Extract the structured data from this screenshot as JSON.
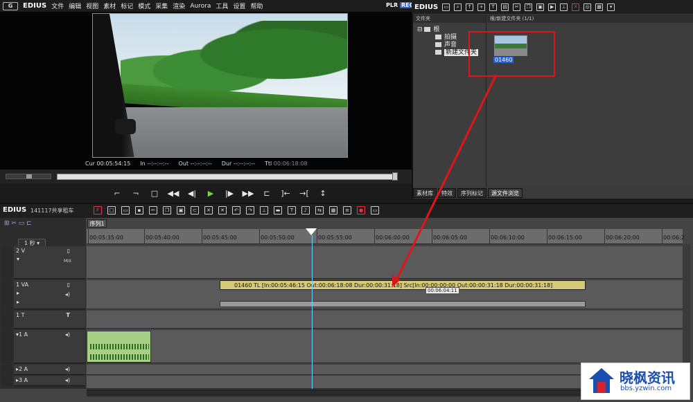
{
  "menubar": {
    "app_name": "EDIUS",
    "items": [
      "文件",
      "编辑",
      "视图",
      "素材",
      "标记",
      "模式",
      "采集",
      "渲染",
      "Aurora",
      "工具",
      "设置",
      "帮助"
    ],
    "plr": "PLR",
    "rec": "REC"
  },
  "preview": {
    "cur_label": "Cur",
    "cur_value": "00:05:54:15",
    "in_label": "In",
    "in_value": "--:--:--:--",
    "out_label": "Out",
    "out_value": "--:--:--:--",
    "dur_label": "Dur",
    "dur_value": "--:--:--:--",
    "ttl_label": "Ttl",
    "ttl_value": "00:06:18:08"
  },
  "bin": {
    "title": "EDIUS",
    "folder_header": "文件夹",
    "file_header": "根/新建文件夹 (1/1)",
    "tree": [
      "根",
      "拍摄",
      "声音",
      "新建文件夹"
    ],
    "clip_name": "01460",
    "tabs": [
      "素材库",
      "特效",
      "序列标记",
      "源文件浏览"
    ]
  },
  "timeline": {
    "app_name": "EDIUS",
    "project": "141117共享租车",
    "sequence_tab": "序列1",
    "zoom": "1 秒",
    "ruler": [
      "00:05:35:00",
      "00:05:40:00",
      "00:05:45:00",
      "00:05:50:00",
      "00:05:55:00",
      "00:06:00:00",
      "00:06:05:00",
      "00:06:10:00",
      "00:06:15:00",
      "00:06:20:00",
      "00:06:2"
    ],
    "tracks": {
      "v2": "2 V",
      "va1": "1 VA",
      "t1": "1 T",
      "a1": "1 A",
      "a2": "2 A",
      "a3": "3 A"
    },
    "mix_label": "MIX",
    "clip_text": "01460  TL [In:00:05:46:15 Out:00:06:18:08 Dur:00:00:31:18]  Src[In:00:00:00:00 Out:00:00:31:18 Dur:00:00:31:18]",
    "tooltip": "00:06:04:11"
  },
  "watermark": {
    "title": "晓枫资讯",
    "url": "bbs.yzwin.com"
  }
}
